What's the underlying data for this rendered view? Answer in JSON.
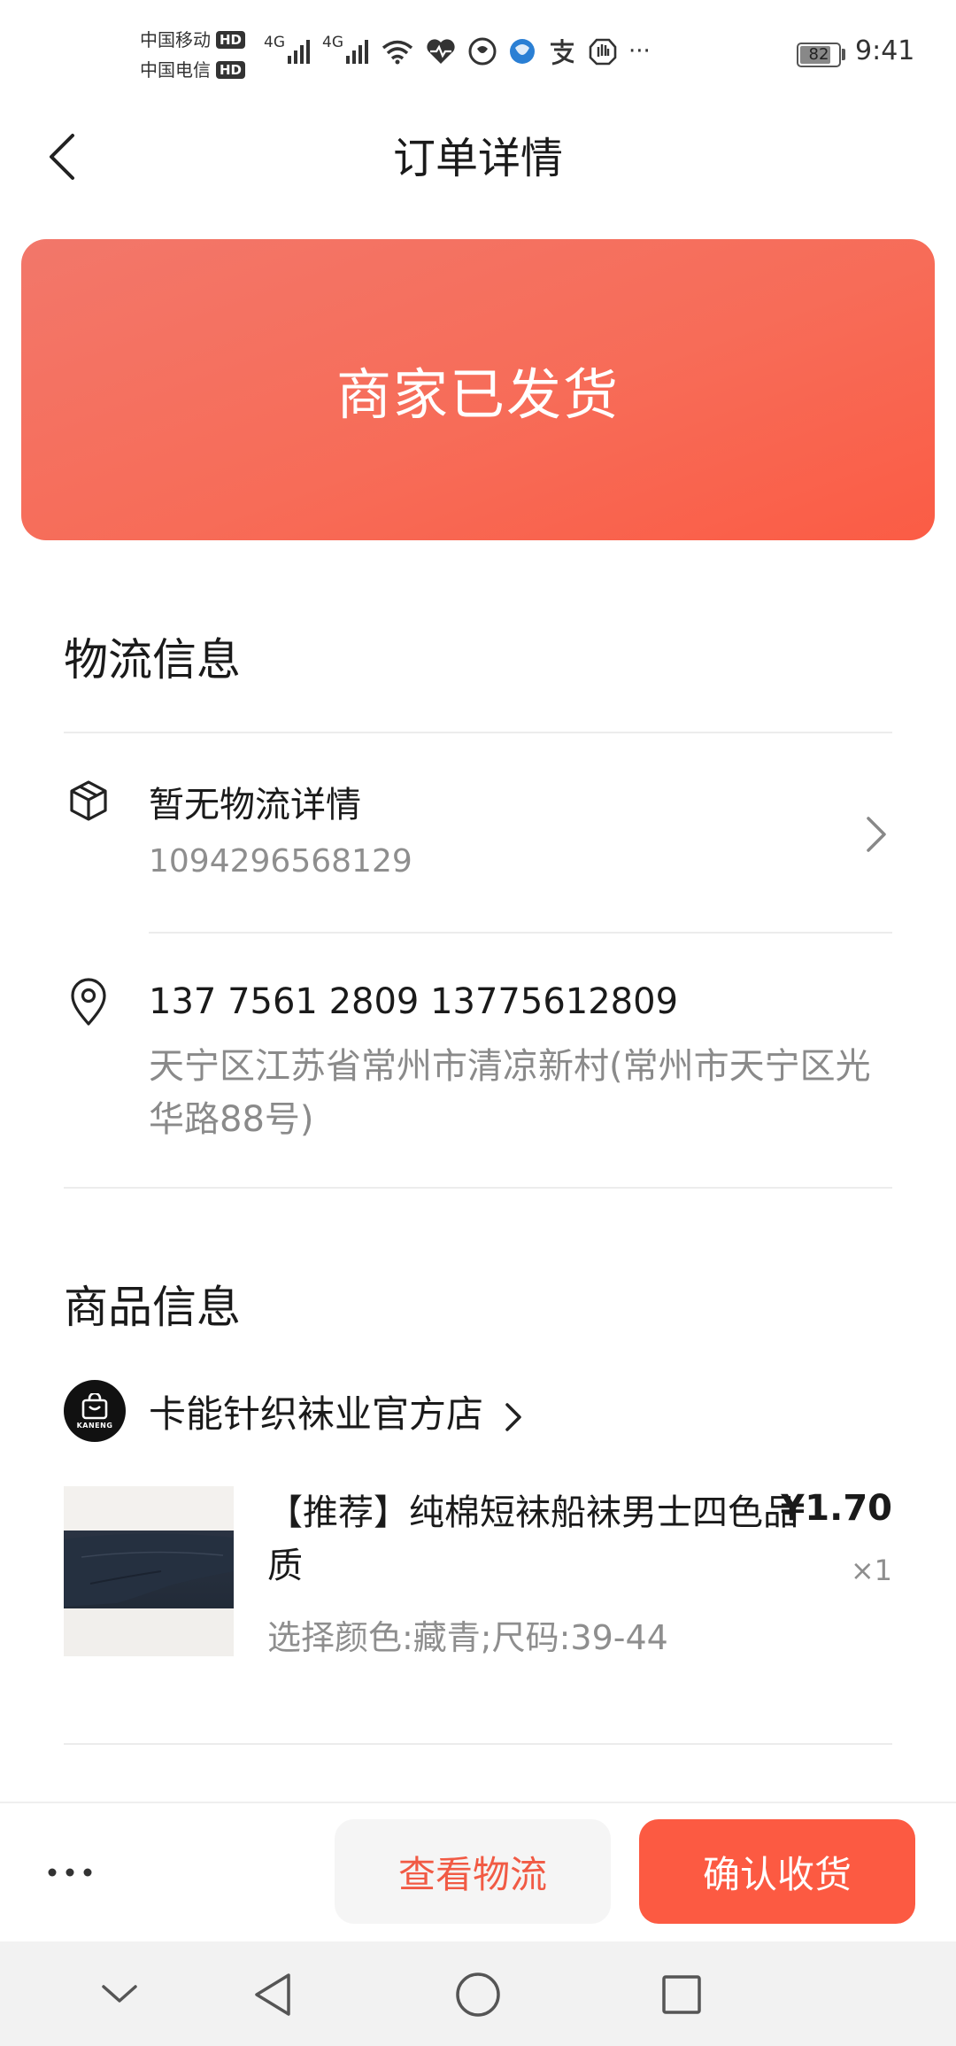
{
  "status_bar": {
    "carrier_1": "中国移动",
    "carrier_2": "中国电信",
    "hd_badge": "HD",
    "network_1": "4G",
    "network_2": "4G",
    "battery_level": "82",
    "battery_fraction": 0.82,
    "time": "9:41",
    "overflow": "···",
    "icons": [
      "signal-icon",
      "signal-icon",
      "wifi-icon",
      "health-heart-icon",
      "app-notification-icon",
      "browser-icon",
      "alipay-icon",
      "hand-icon",
      "more-icon"
    ]
  },
  "nav": {
    "title": "订单详情",
    "back_icon": "chevron-left-icon"
  },
  "banner": {
    "status_text": "商家已发货",
    "gradient_colors": [
      "#f2776a",
      "#fb5c45"
    ]
  },
  "logistics": {
    "section_title": "物流信息",
    "status_text": "暂无物流详情",
    "tracking_number": "1094296568129",
    "box_icon": "package-icon",
    "chevron_icon": "chevron-right-icon",
    "contact_phones": "137 7561 2809 13775612809",
    "address": "天宁区江苏省常州市清凉新村(常州市天宁区光华路88号)",
    "location_icon": "location-pin-icon"
  },
  "goods": {
    "section_title": "商品信息",
    "store_name": "卡能针织袜业官方店",
    "store_logo_text": "KANENG",
    "product_title": "【推荐】纯棉短袜船袜男士四色品质",
    "product_price": "¥1.70",
    "product_qty": "×1",
    "product_spec": "选择颜色:藏青;尺码:39-44"
  },
  "actions": {
    "more_label": "···",
    "view_logistics": "查看物流",
    "confirm_receipt": "确认收货",
    "accent_color": "#fc5a42"
  },
  "system_nav": {
    "buttons": [
      "chevron-down-icon",
      "back-triangle-icon",
      "home-circle-icon",
      "recents-square-icon"
    ]
  }
}
